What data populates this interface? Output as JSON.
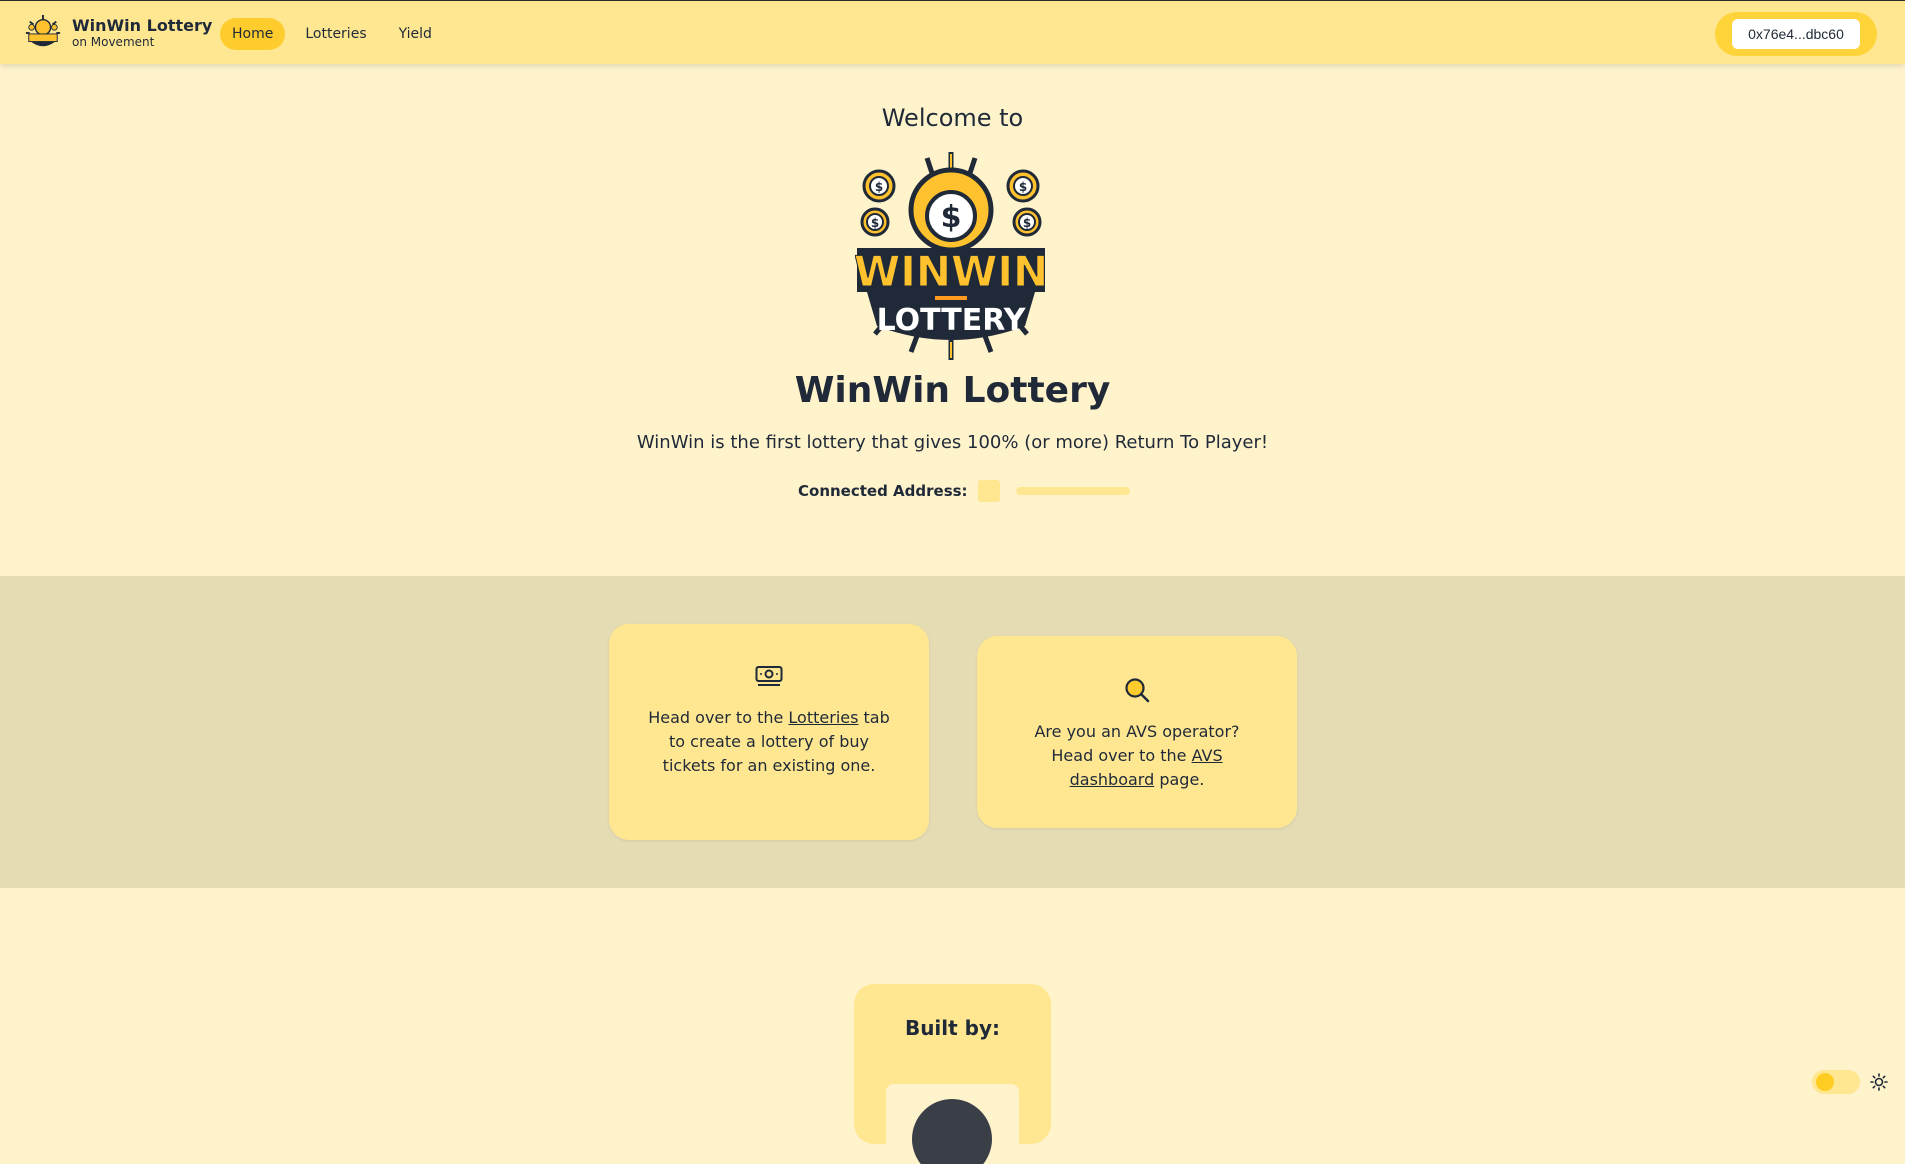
{
  "navbar": {
    "brand_title": "WinWin Lottery",
    "brand_subtitle": "on Movement",
    "nav_items": [
      {
        "label": "Home",
        "active": true
      },
      {
        "label": "Lotteries",
        "active": false
      },
      {
        "label": "Yield",
        "active": false
      }
    ],
    "wallet_address": "0x76e4...dbc60"
  },
  "hero": {
    "welcome": "Welcome to",
    "logo_icon": "winwin-lottery-logo",
    "logo_text": "WINWIN LOTTERY",
    "title": "WinWin Lottery",
    "tagline": "WinWin is the first lottery that gives 100% (or more) Return To Player!",
    "connected_label": "Connected Address:"
  },
  "cards": [
    {
      "icon": "banknote-icon",
      "text_before": "Head over to the ",
      "link": "Lotteries",
      "text_after": " tab to create a lottery of buy tickets for an existing one."
    },
    {
      "icon": "search-icon",
      "text_before": "Are you an AVS operator? Head over to the ",
      "link": "AVS dashboard",
      "text_after": " page."
    }
  ],
  "built_by": {
    "title": "Built by:"
  },
  "theme": {
    "toggle_icon": "sun-icon",
    "accent": "#ffcc2e",
    "background": "#fff3cc",
    "band": "#e5dcb4"
  }
}
